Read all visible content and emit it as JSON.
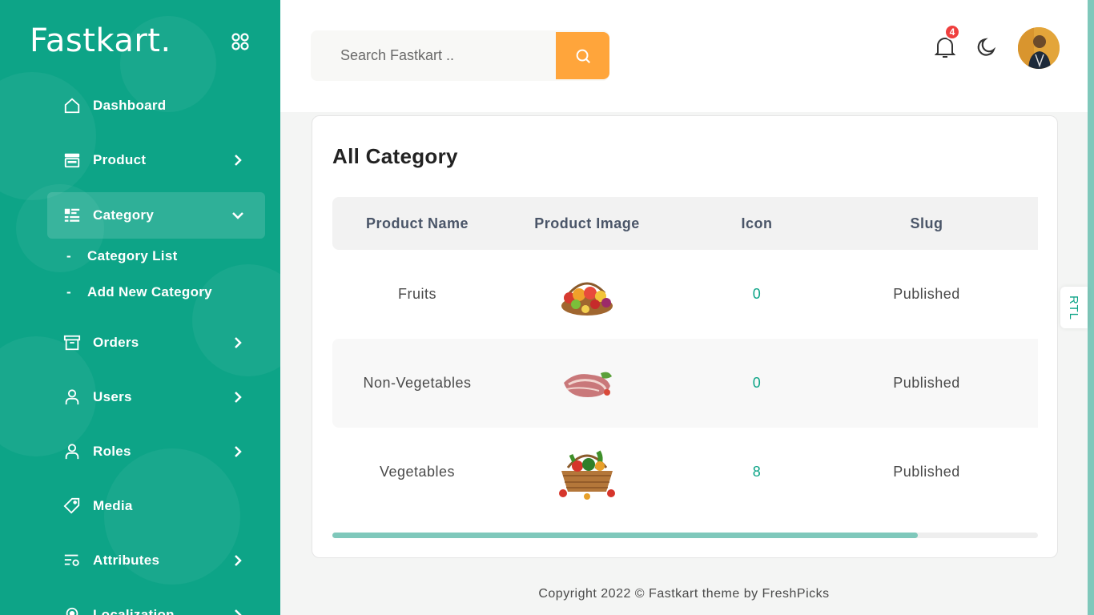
{
  "app": {
    "logo": "Fastkart.",
    "colors": {
      "primary": "#0da487",
      "accent": "#ffa53b",
      "badge": "#ef3f3e"
    }
  },
  "sidebar": {
    "menu_icon": "grid-icon",
    "items": [
      {
        "label": "Dashboard",
        "icon": "home-icon",
        "has_chevron": false
      },
      {
        "label": "Product",
        "icon": "store-icon",
        "has_chevron": true
      },
      {
        "label": "Category",
        "icon": "list-icon",
        "has_chevron": true,
        "expanded": true
      },
      {
        "label": "Orders",
        "icon": "archive-icon",
        "has_chevron": true
      },
      {
        "label": "Users",
        "icon": "user-icon",
        "has_chevron": true
      },
      {
        "label": "Roles",
        "icon": "user-icon",
        "has_chevron": true
      },
      {
        "label": "Media",
        "icon": "tag-icon",
        "has_chevron": false
      },
      {
        "label": "Attributes",
        "icon": "settings-list-icon",
        "has_chevron": true
      },
      {
        "label": "Localization",
        "icon": "location-icon",
        "has_chevron": true
      }
    ],
    "subitems": [
      {
        "label": "Category List"
      },
      {
        "label": "Add New Category"
      }
    ]
  },
  "header": {
    "search_placeholder": "Search Fastkart ..",
    "notification_count": "4"
  },
  "main": {
    "title": "All Category",
    "columns": [
      "Product Name",
      "Product Image",
      "Icon",
      "Slug"
    ],
    "rows": [
      {
        "name": "Fruits",
        "image": "fruit-basket-image",
        "icon": "0",
        "slug": "Published"
      },
      {
        "name": "Non-Vegetables",
        "image": "meat-image",
        "icon": "0",
        "slug": "Published"
      },
      {
        "name": "Vegetables",
        "image": "vegetable-basket-image",
        "icon": "8",
        "slug": "Published"
      }
    ],
    "horizontal_scroll_fraction": 0.83
  },
  "rtl_label": "RTL",
  "footer": {
    "text": "Copyright 2022 © Fastkart theme by FreshPicks"
  }
}
